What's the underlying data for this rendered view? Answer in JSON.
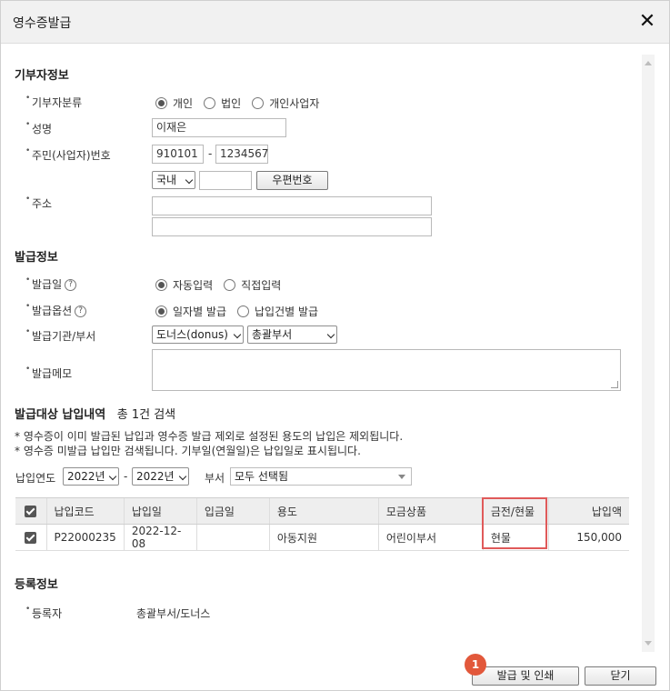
{
  "window": {
    "title": "영수증발급"
  },
  "donor": {
    "section_title": "기부자정보",
    "type_label": "기부자분류",
    "type_options": [
      "개인",
      "법인",
      "개인사업자"
    ],
    "type_selected": "개인",
    "name_label": "성명",
    "name_value": "이재은",
    "id_label": "주민(사업자)번호",
    "id_part1": "910101",
    "id_separator": "-",
    "id_part2": "1234567",
    "address_label": "주소",
    "country_value": "국내",
    "zip_value": "",
    "zip_button": "우편번호",
    "address1": "",
    "address2": ""
  },
  "issue": {
    "section_title": "발급정보",
    "date_label": "발급일",
    "date_options": [
      "자동입력",
      "직접입력"
    ],
    "date_selected": "자동입력",
    "option_label": "발급옵션",
    "option_options": [
      "일자별 발급",
      "납입건별 발급"
    ],
    "option_selected": "일자별 발급",
    "org_label": "발급기관/부서",
    "org_value": "도너스(donus)",
    "dept_value": "총괄부서",
    "memo_label": "발급메모",
    "memo_value": ""
  },
  "payments": {
    "section_title": "발급대상 납입내역",
    "count_text": "총 1건 검색",
    "notes": [
      "* 영수증이 이미 발급된 납입과 영수증 발급 제외로 설정된 용도의 납입은 제외됩니다.",
      "* 영수증 미발급 납입만 검색됩니다. 기부일(연월일)은 납입일로 표시됩니다."
    ],
    "year_label": "납입연도",
    "year_from": "2022년",
    "year_sep": "-",
    "year_to": "2022년",
    "dept_label": "부서",
    "dept_value": "모두 선택됨",
    "columns": [
      "",
      "납입코드",
      "납입일",
      "입금일",
      "용도",
      "모금상품",
      "금전/현물",
      "납입액"
    ],
    "rows": [
      {
        "code": "P22000235",
        "pay_date": "2022-12-08",
        "deposit_date": "",
        "purpose": "아동지원",
        "product": "어린이부서",
        "kind": "현물",
        "amount": "150,000"
      }
    ]
  },
  "registration": {
    "section_title": "등록정보",
    "registrant_label": "등록자",
    "registrant_value": "총괄부서/도너스"
  },
  "footer": {
    "badge": "1",
    "issue_print_button": "발급 및 인쇄",
    "close_button": "닫기"
  },
  "colors": {
    "highlight": "#e05a5a",
    "badge": "#e2583b"
  }
}
